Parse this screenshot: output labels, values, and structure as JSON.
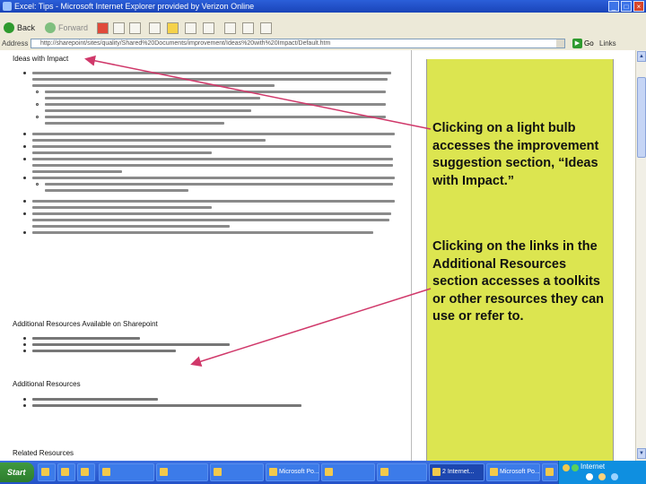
{
  "window": {
    "title": "Excel: Tips - Microsoft Internet Explorer provided by Verizon Online"
  },
  "toolbar": {
    "back_label": "Back",
    "forward_label": "Forward"
  },
  "address": {
    "label": "Address",
    "url": "http://sharepoint/sites/quality/Shared%20Documents/improvement/Ideas%20with%20Impact/Default.htm",
    "go_label": "Go",
    "links_label": "Links"
  },
  "page": {
    "section1_title": "Ideas with Impact",
    "section2_title": "Additional Resources Available on Sharepoint",
    "section3_title": "Additional Resources",
    "section4_title": "Related Resources"
  },
  "callouts": {
    "first": "Clicking on a light bulb accesses the improvement suggestion section, “Ideas with Impact.”",
    "second": "Clicking on the links in the Additional Resources section accesses a toolkits or other resources they can use or refer to."
  },
  "taskbar": {
    "start_label": "Start",
    "tasks": [
      "",
      "",
      "",
      "Microsoft Po...",
      "",
      "",
      "2 Internet...",
      "Microsoft Po...",
      ""
    ],
    "tray_label": "Internet"
  },
  "colors": {
    "callout_background": "#dce550",
    "arrow_color": "#d0386a",
    "titlebar": "#2b5fd9",
    "taskbar": "#2452c8"
  }
}
